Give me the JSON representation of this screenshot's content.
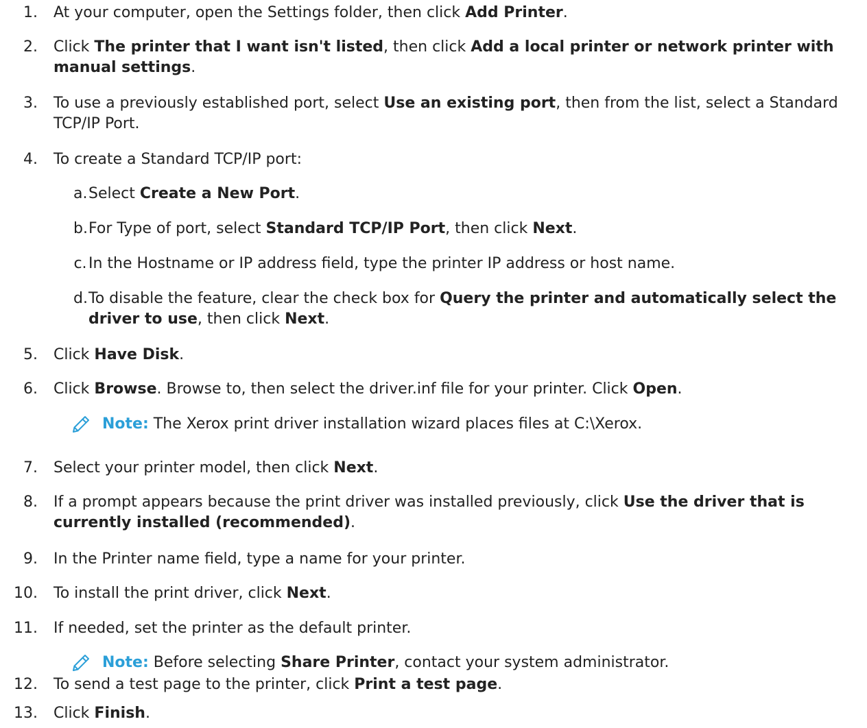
{
  "steps": [
    {
      "num": "1.",
      "parts": [
        "At your computer, open the Settings folder, then click ",
        "Add Printer",
        "."
      ]
    },
    {
      "num": "2.",
      "parts": [
        "Click ",
        "The printer that I want isn't listed",
        ", then click ",
        "Add a local printer or network printer with manual settings",
        "."
      ]
    },
    {
      "num": "3.",
      "parts": [
        "To use a previously established port, select ",
        "Use an existing port",
        ", then from the list, select a Standard TCP/IP Port."
      ]
    },
    {
      "num": "4.",
      "parts": [
        "To create a Standard TCP/IP port:"
      ]
    },
    {
      "num": "5.",
      "parts": [
        "Click ",
        "Have Disk",
        "."
      ]
    },
    {
      "num": "6.",
      "parts": [
        "Click ",
        "Browse",
        ". Browse to, then select the driver.inf file for your printer. Click ",
        "Open",
        "."
      ]
    },
    {
      "num": "7.",
      "parts": [
        "Select your printer model, then click ",
        "Next",
        "."
      ]
    },
    {
      "num": "8.",
      "parts": [
        "If a prompt appears because the print driver was installed previously, click ",
        "Use the driver that is currently installed (recommended)",
        "."
      ]
    },
    {
      "num": "9.",
      "parts": [
        " In the Printer name field, type a name for your printer."
      ]
    },
    {
      "num": "10.",
      "parts": [
        "To install the print driver, click ",
        "Next",
        "."
      ]
    },
    {
      "num": "11.",
      "parts": [
        "If needed, set the printer as the default printer."
      ]
    },
    {
      "num": "12.",
      "parts": [
        "To send a test page to the printer, click ",
        "Print a test page",
        "."
      ]
    },
    {
      "num": "13.",
      "parts": [
        "Click ",
        "Finish",
        "."
      ]
    }
  ],
  "substeps": [
    {
      "letter": "a.",
      "parts": [
        "Select ",
        "Create a New Port",
        "."
      ]
    },
    {
      "letter": "b.",
      "parts": [
        "For Type of port, select ",
        "Standard TCP/IP Port",
        ", then click ",
        "Next",
        "."
      ]
    },
    {
      "letter": "c.",
      "parts": [
        "In the Hostname or IP address field, type the printer IP address or host name."
      ]
    },
    {
      "letter": "d.",
      "parts": [
        "To disable the feature, clear the check box for ",
        "Query the printer and automatically select the driver to use",
        ", then click ",
        "Next",
        "."
      ]
    }
  ],
  "notes": [
    {
      "label": "Note:",
      "parts": [
        " The Xerox print driver installation wizard places files at C:\\Xerox."
      ]
    },
    {
      "label": "Note:",
      "parts": [
        " Before selecting ",
        "Share Printer",
        ", contact your system administrator."
      ]
    }
  ],
  "colors": {
    "note_label": "#2b9fd8",
    "text": "#222222"
  },
  "icons": {
    "note": "pencil-icon"
  }
}
